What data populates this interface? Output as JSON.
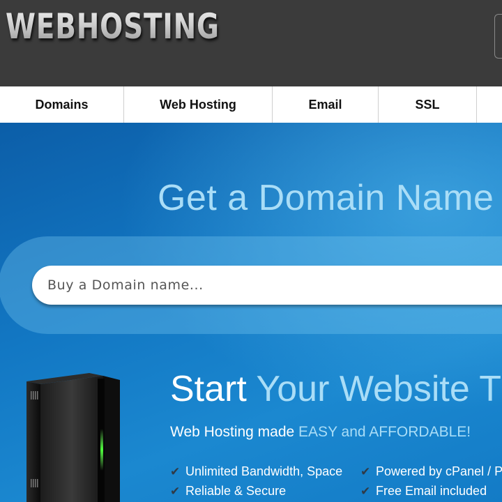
{
  "header": {
    "logo_text": "WEBHOSTING"
  },
  "nav": {
    "items": [
      {
        "label": "Domains"
      },
      {
        "label": "Web Hosting"
      },
      {
        "label": "Email"
      },
      {
        "label": "SSL"
      },
      {
        "label": ""
      }
    ]
  },
  "hero": {
    "title": "Get a Domain Name",
    "search": {
      "placeholder": "Buy a Domain name...",
      "value": ""
    },
    "subtitle_main": "Start",
    "subtitle_accent": "Your Website T",
    "tagline_main": "Web Hosting made",
    "tagline_accent": "EASY and AFFORDABLE!",
    "features": [
      {
        "label": "Unlimited Bandwidth, Space"
      },
      {
        "label": "Powered by cPanel / Pl"
      },
      {
        "label": "Reliable & Secure"
      },
      {
        "label": "Free Email included"
      }
    ],
    "icons": {
      "check": "checkmark-icon",
      "server": "server-tower-image"
    }
  },
  "colors": {
    "header_bg": "#3b3b3b",
    "hero_blue": "#1277c3",
    "accent_light_blue": "#a9ddf7",
    "nav_bg": "#ffffff"
  }
}
